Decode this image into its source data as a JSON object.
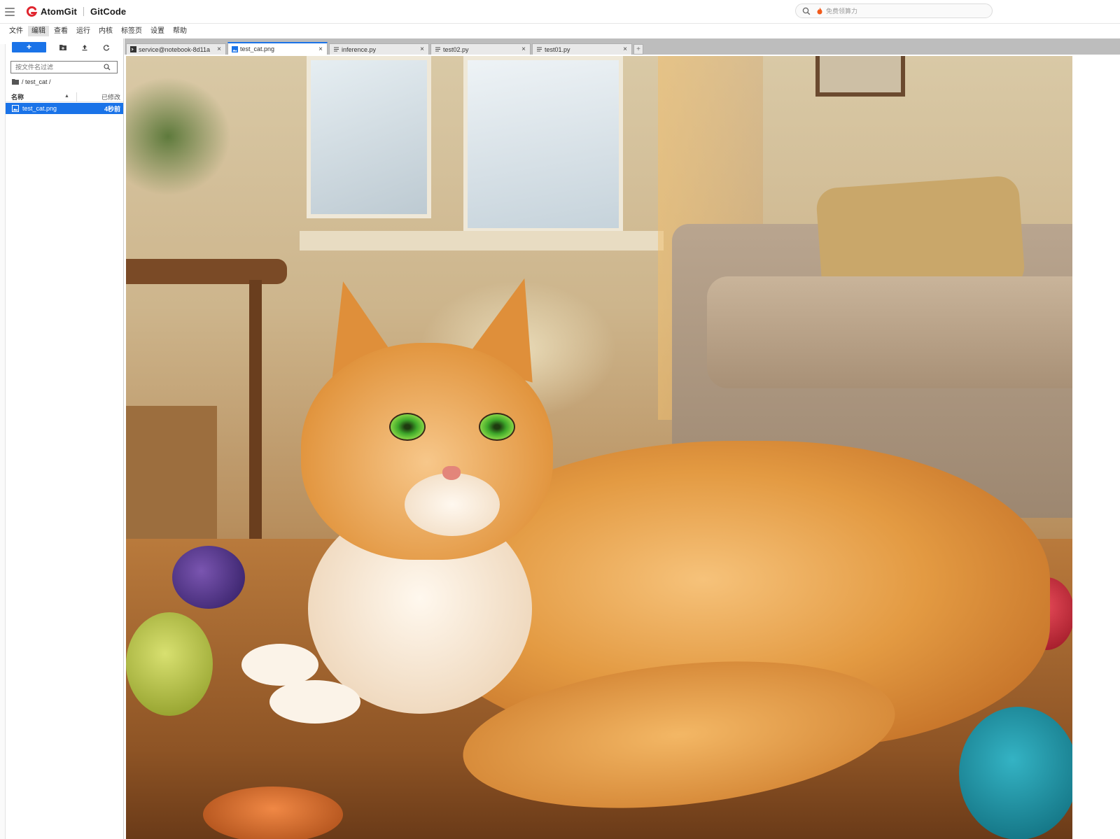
{
  "header": {
    "brand_left": "AtomGit",
    "brand_right": "GitCode",
    "search_placeholder": "免费领算力"
  },
  "menu": [
    {
      "label": "文件"
    },
    {
      "label": "编辑"
    },
    {
      "label": "查看"
    },
    {
      "label": "运行"
    },
    {
      "label": "内核"
    },
    {
      "label": "标签页"
    },
    {
      "label": "设置"
    },
    {
      "label": "帮助"
    }
  ],
  "sidebar": {
    "new_button": "+",
    "filter_placeholder": "按文件名过滤",
    "breadcrumb": "/ test_cat /",
    "columns": {
      "name": "名称",
      "modified": "已修改"
    },
    "files": [
      {
        "name": "test_cat.png",
        "modified": "4秒前",
        "selected": true
      }
    ]
  },
  "tabs": [
    {
      "label": "service@notebook-8d11a",
      "icon": "terminal-icon",
      "active": false
    },
    {
      "label": "test_cat.png",
      "icon": "image-icon",
      "active": true
    },
    {
      "label": "inference.py",
      "icon": "file-text-icon",
      "active": false
    },
    {
      "label": "test02.py",
      "icon": "file-text-icon",
      "active": false
    },
    {
      "label": "test01.py",
      "icon": "file-text-icon",
      "active": false
    }
  ],
  "tab_close": "×",
  "tab_add": "+",
  "viewer": {
    "image_name": "test_cat.png"
  },
  "colors": {
    "accent": "#1a73e8",
    "brand_red": "#e0262f"
  }
}
